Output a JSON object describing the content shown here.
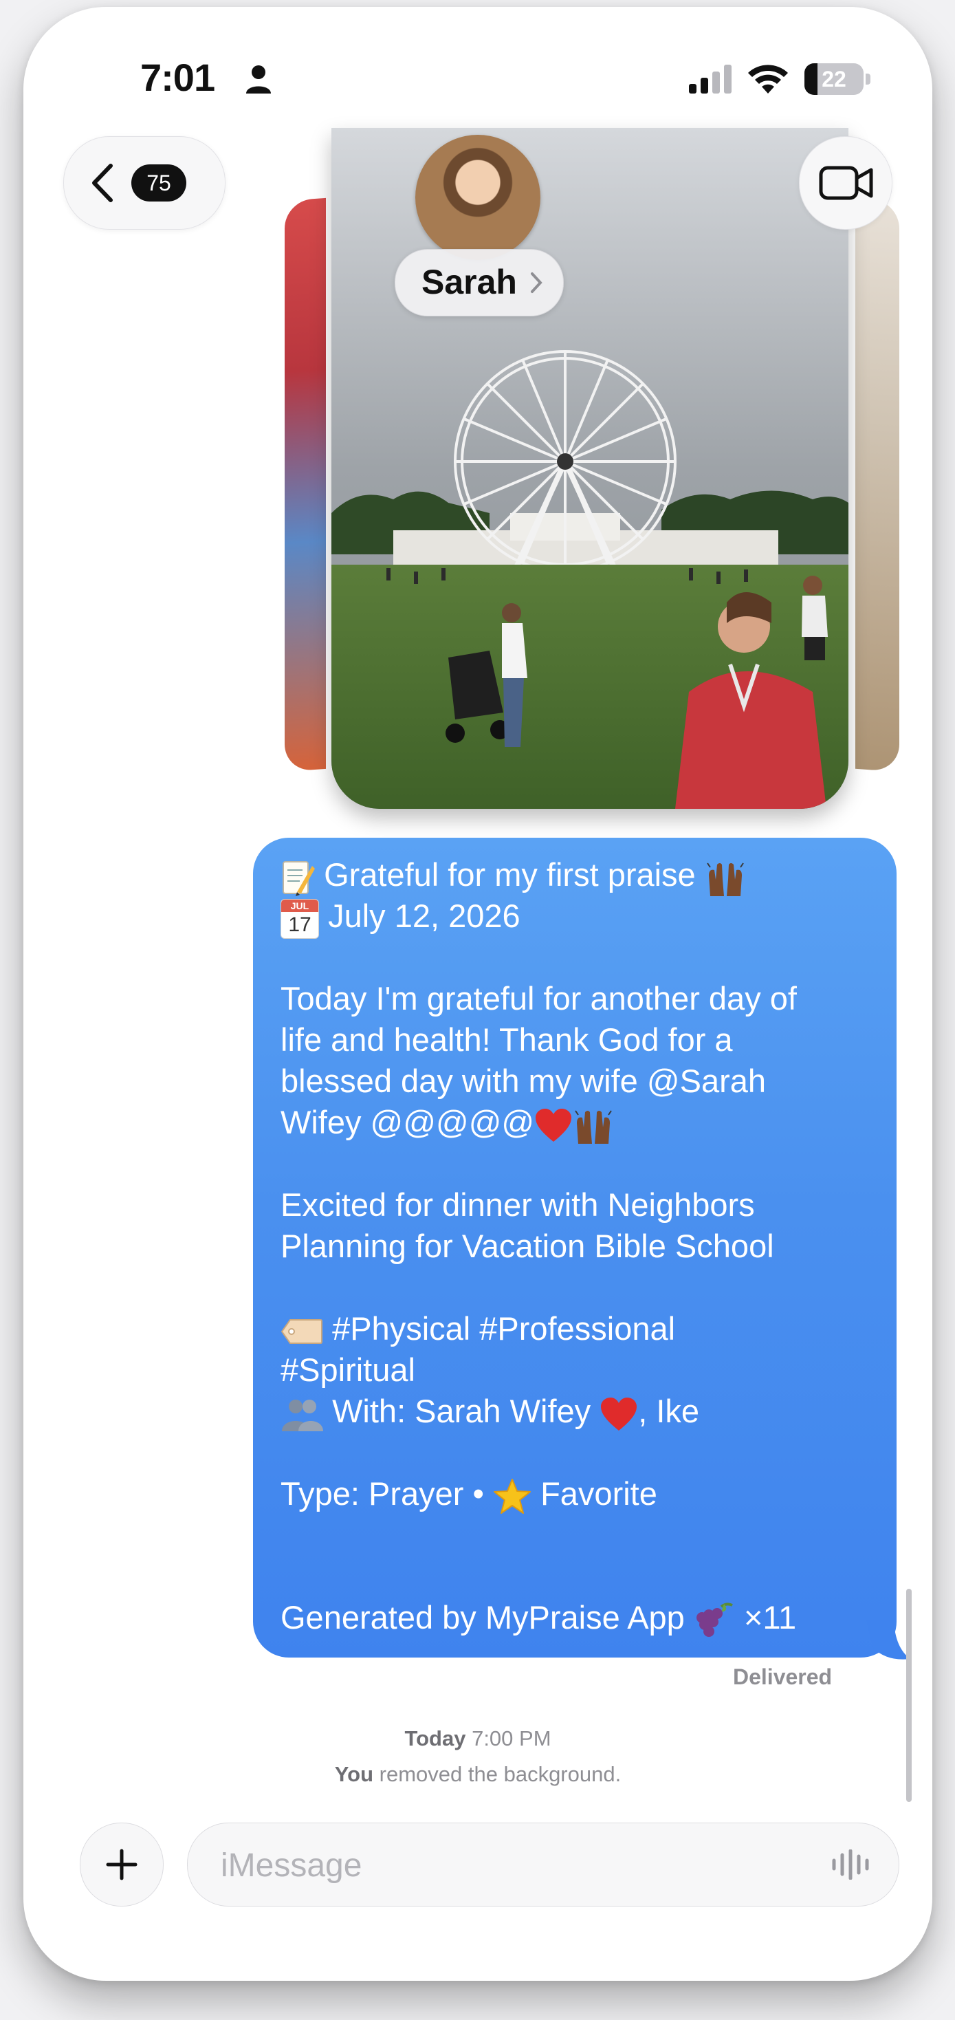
{
  "status_bar": {
    "time": "7:01",
    "battery_level": "22",
    "battery_fraction": 0.22
  },
  "nav": {
    "back_count": "75",
    "contact_name": "Sarah"
  },
  "message": {
    "line1": "Grateful for my first praise",
    "line2": "July 12, 2026",
    "line3": "Today I'm grateful for another day of",
    "line4": "life and health! Thank God for a",
    "line5": "blessed day with my wife @Sarah",
    "line6": "Wifey @@@@@",
    "line7": "Excited for dinner with Neighbors",
    "line8": "Planning for Vacation Bible School",
    "line9": "#Physical #Professional",
    "line10": "#Spiritual",
    "line11a": "With: Sarah Wifey",
    "line11b": ", Ike",
    "line12a": "Type: Prayer • ",
    "line12b": "Favorite",
    "line13a": "Generated by MyPraise App",
    "line13b": "×11",
    "calendar_month": "JUL",
    "calendar_day": "17",
    "status": "Delivered"
  },
  "timeline": {
    "day": "Today",
    "time": "7:00 PM",
    "actor": "You",
    "note": "removed the background."
  },
  "composer": {
    "placeholder": "iMessage"
  },
  "icons": {
    "back": "chevron-left-icon",
    "video": "video-camera-icon",
    "plus": "plus-icon",
    "audio": "waveform-icon",
    "memo": "memo-icon",
    "calendar": "calendar-icon",
    "tag": "tag-icon",
    "people": "people-icon",
    "heart": "red-heart-icon",
    "raised_hands": "raised-hands-icon",
    "star": "star-icon",
    "grapes": "grapes-icon"
  },
  "colors": {
    "bubble": "#4a90ef",
    "heart": "#e02b2b",
    "hands": "#7a4a2c",
    "star": "#f7c21a",
    "grapes": "#7a3c8c"
  }
}
